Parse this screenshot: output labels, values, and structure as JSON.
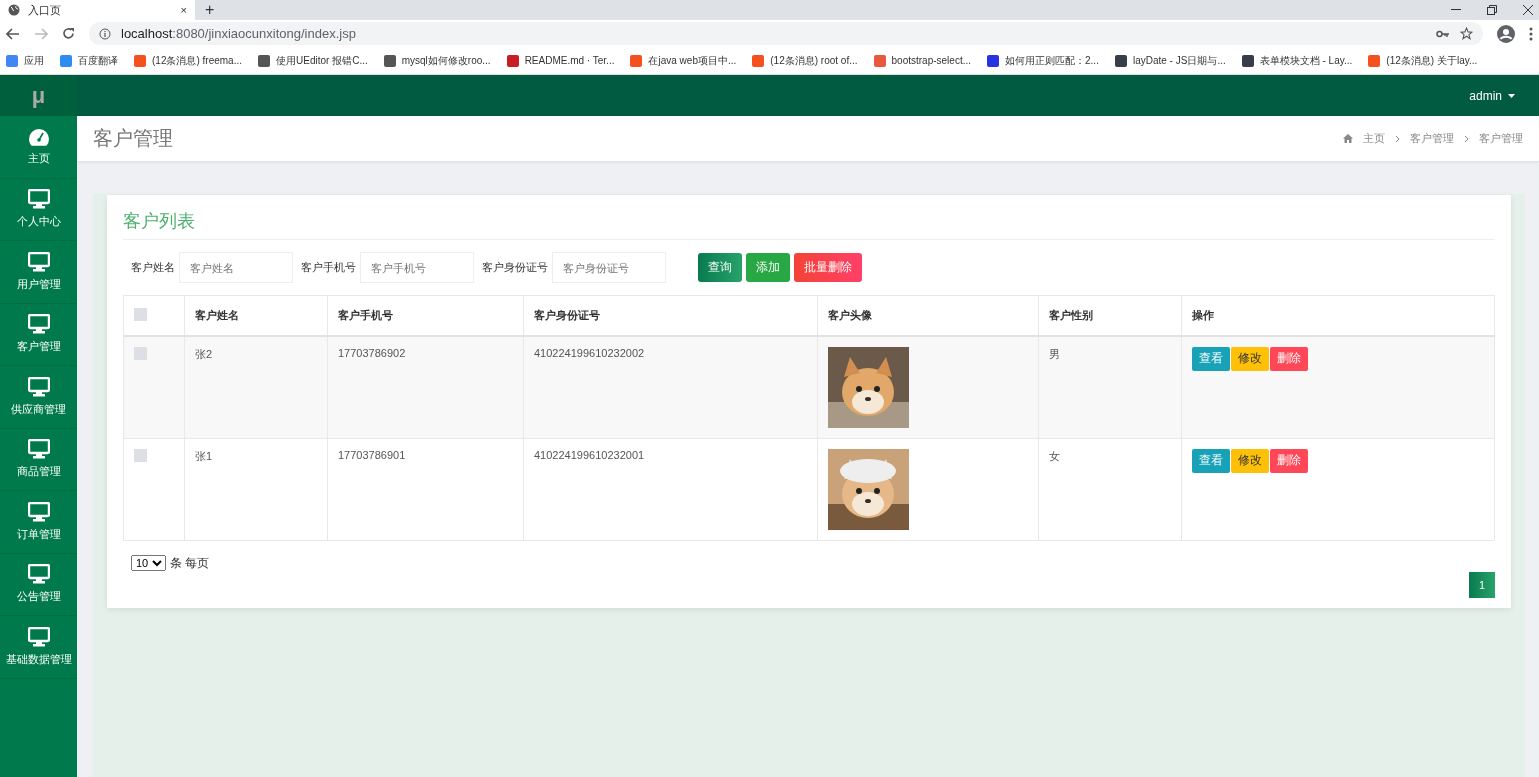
{
  "browser": {
    "tab": {
      "title": "入口页",
      "close": "×"
    },
    "new_tab": "+",
    "url_host": "localhost",
    "url_rest": ":8080/jinxiaocunxitong/index.jsp",
    "bookmarks": [
      {
        "label": "应用",
        "color": "#4285f4"
      },
      {
        "label": "百度翻译",
        "color": "#2d8cf0"
      },
      {
        "label": "(12条消息) freema...",
        "color": "#f4511e"
      },
      {
        "label": "使用UEditor 报错C...",
        "color": "#555555"
      },
      {
        "label": "mysql如何修改roo...",
        "color": "#555555"
      },
      {
        "label": "README.md · Ter...",
        "color": "#c71d23"
      },
      {
        "label": "在java web项目中...",
        "color": "#f4511e"
      },
      {
        "label": "(12条消息) root of...",
        "color": "#f4511e"
      },
      {
        "label": "bootstrap-select...",
        "color": "#e9573f"
      },
      {
        "label": "如何用正则匹配：2...",
        "color": "#2932e1"
      },
      {
        "label": "layDate - JS日期与...",
        "color": "#393d49"
      },
      {
        "label": "表单模块文档 - Lay...",
        "color": "#393d49"
      },
      {
        "label": "(12条消息) 关于lay...",
        "color": "#f4511e"
      }
    ]
  },
  "app": {
    "logo": "μ",
    "user": "admin"
  },
  "sidebar": {
    "items": [
      {
        "label": "主页",
        "kind": "dashboard"
      },
      {
        "label": "个人中心",
        "kind": "monitor"
      },
      {
        "label": "用户管理",
        "kind": "monitor"
      },
      {
        "label": "客户管理",
        "kind": "monitor"
      },
      {
        "label": "供应商管理",
        "kind": "monitor"
      },
      {
        "label": "商品管理",
        "kind": "monitor"
      },
      {
        "label": "订单管理",
        "kind": "monitor"
      },
      {
        "label": "公告管理",
        "kind": "monitor"
      },
      {
        "label": "基础数据管理",
        "kind": "monitor"
      }
    ]
  },
  "page": {
    "title": "客户管理",
    "breadcrumb": [
      "主页",
      "客户管理",
      "客户管理"
    ]
  },
  "card": {
    "title": "客户列表",
    "filters": [
      {
        "label": "客户姓名",
        "placeholder": "客户姓名"
      },
      {
        "label": "客户手机号",
        "placeholder": "客户手机号"
      },
      {
        "label": "客户身份证号",
        "placeholder": "客户身份证号"
      }
    ],
    "buttons": [
      {
        "label": "查询",
        "kind": "search"
      },
      {
        "label": "添加",
        "kind": "add"
      },
      {
        "label": "批量删除",
        "kind": "danger"
      }
    ],
    "table": {
      "header_checked": false,
      "columns": [
        "客户姓名",
        "客户手机号",
        "客户身份证号",
        "客户头像",
        "客户性别",
        "操作"
      ],
      "rows": [
        {
          "checked": false,
          "name": "张2",
          "phone": "17703786902",
          "id_number": "410224199610232002",
          "gender": "男",
          "actions": [
            {
              "label": "查看",
              "kind": "view"
            },
            {
              "label": "修改",
              "kind": "edit"
            },
            {
              "label": "删除",
              "kind": "delete"
            }
          ]
        },
        {
          "checked": false,
          "name": "张1",
          "phone": "17703786901",
          "id_number": "410224199610232001",
          "gender": "女",
          "actions": [
            {
              "label": "查看",
              "kind": "view"
            },
            {
              "label": "修改",
              "kind": "edit"
            },
            {
              "label": "删除",
              "kind": "delete"
            }
          ]
        }
      ]
    },
    "page_size": "10",
    "page_size_suffix": "条 每页",
    "pages": [
      {
        "label": "1",
        "selected": true
      }
    ]
  }
}
